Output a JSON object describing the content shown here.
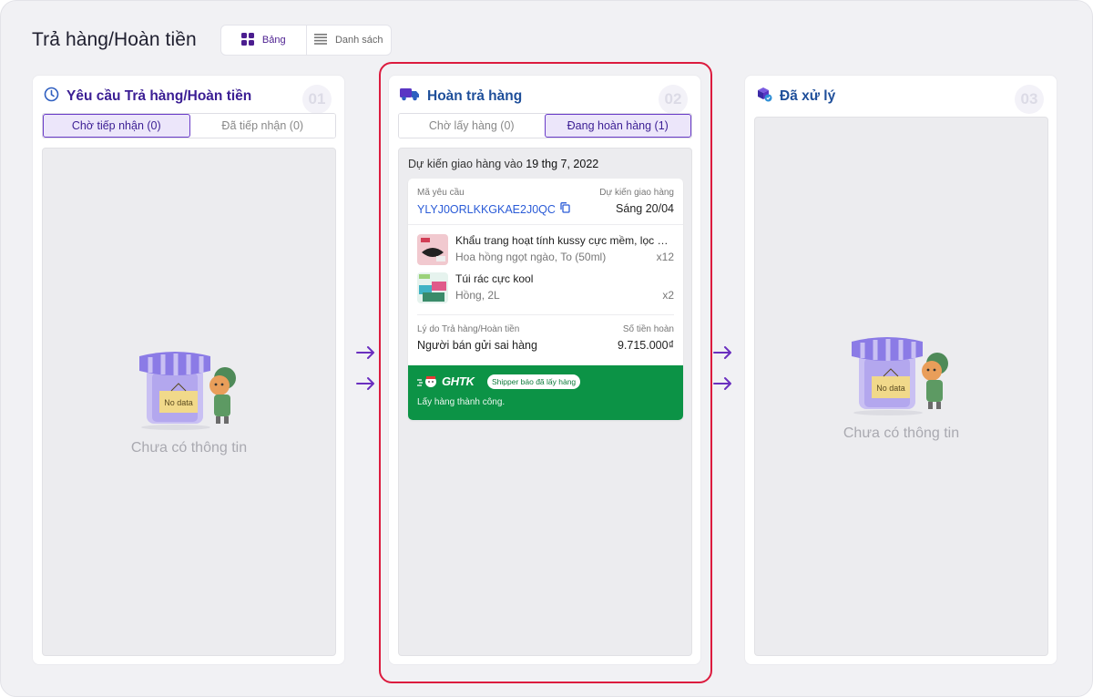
{
  "page": {
    "title": "Trả hàng/Hoàn tiền",
    "view_toggle": {
      "board_label": "Bảng",
      "list_label": "Danh sách",
      "active": "board"
    }
  },
  "columns": [
    {
      "title": "Yêu cầu Trả hàng/Hoàn tiền",
      "number": "01",
      "icon": "clock-icon",
      "tabs": [
        {
          "label": "Chờ tiếp nhận (0)",
          "active": true
        },
        {
          "label": "Đã tiếp nhận (0)",
          "active": false
        }
      ],
      "empty": {
        "badge": "No data",
        "message": "Chưa có thông tin"
      }
    },
    {
      "title": "Hoàn trả hàng",
      "number": "02",
      "icon": "truck-icon",
      "tabs": [
        {
          "label": "Chờ lấy hàng (0)",
          "active": false
        },
        {
          "label": "Đang hoàn hàng  (1)",
          "active": true
        }
      ],
      "group_prefix": "Dự kiến giao hàng vào ",
      "group_date": "19 thg 7, 2022",
      "card": {
        "request_code_label": "Mã yêu cầu",
        "request_code": "YLYJ0ORLKKGKAE2J0QC",
        "expected_label": "Dự kiến giao hàng",
        "expected_value": "Sáng 20/04",
        "items": [
          {
            "name": "Khẩu trang hoạt tính kussy cực mềm, lọc bụi siêu mịn",
            "variant": "Hoa hồng ngọt ngào, To (50ml)",
            "qty": "x12"
          },
          {
            "name": "Túi rác cực kool",
            "variant": "Hồng, 2L",
            "qty": "x2"
          }
        ],
        "reason_label": "Lý do Trả hàng/Hoàn tiền",
        "reason_value": "Người bán gửi sai hàng",
        "refund_label": "Số tiền hoàn",
        "refund_value": "9.715.000₫",
        "carrier": "GHTK",
        "carrier_status": "Shipper báo đã lấy hàng",
        "carrier_note": "Lấy hàng thành công.",
        "carrier_color": "#0c9346"
      }
    },
    {
      "title": "Đã xử lý",
      "number": "03",
      "icon": "box-check-icon",
      "empty": {
        "badge": "No data",
        "message": "Chưa có thông tin"
      }
    }
  ],
  "colors": {
    "accent": "#3b1e94",
    "highlight": "#dc1b3e",
    "link": "#2a5bd7"
  }
}
